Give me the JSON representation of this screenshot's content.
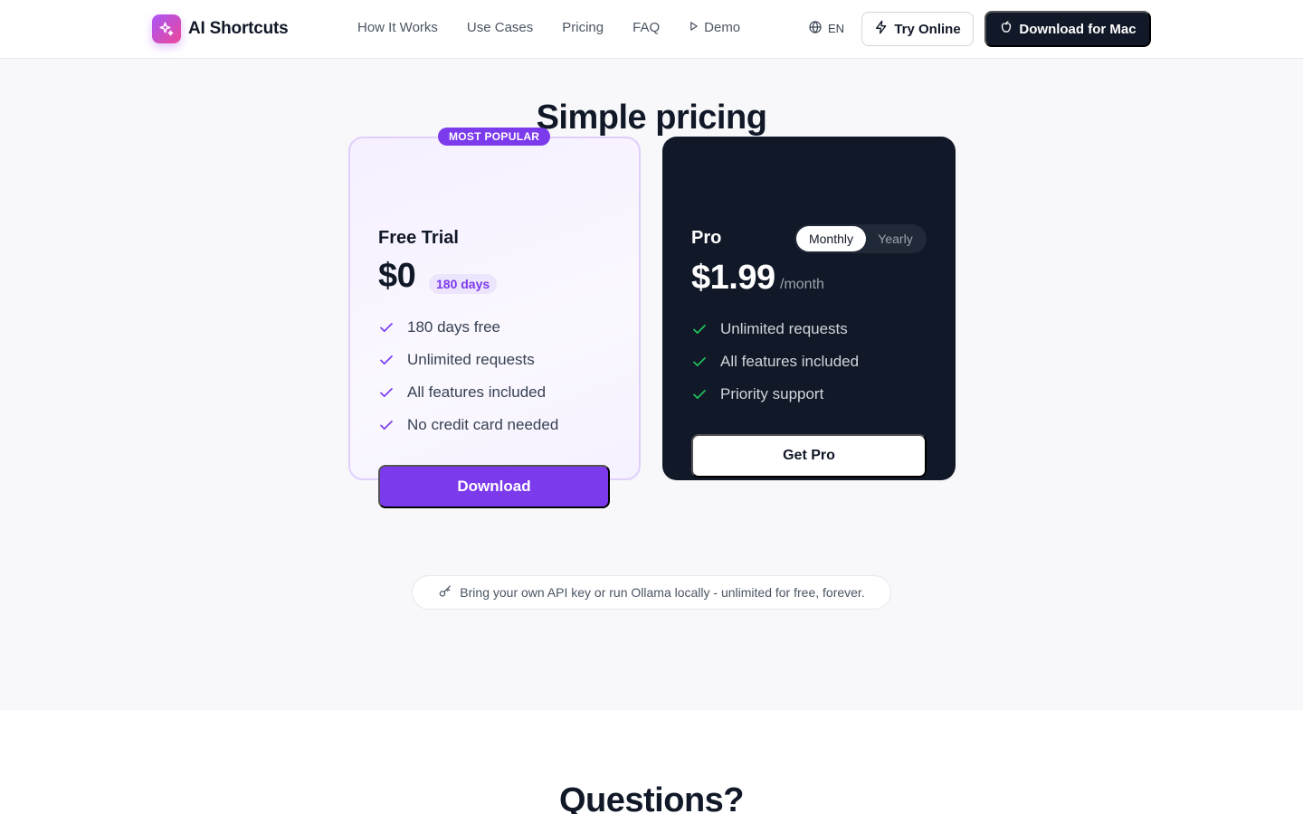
{
  "brand": {
    "name": "AI Shortcuts",
    "logo_icon": "sparkles-icon"
  },
  "nav": {
    "items": [
      {
        "label": "How It Works"
      },
      {
        "label": "Use Cases"
      },
      {
        "label": "Pricing"
      },
      {
        "label": "FAQ"
      },
      {
        "label": "Demo",
        "icon": "play-icon"
      }
    ]
  },
  "header": {
    "language": "EN",
    "try_online": "Try Online",
    "download_mac": "Download for Mac"
  },
  "pricing": {
    "title": "Simple pricing",
    "free": {
      "badge": "MOST POPULAR",
      "name": "Free Trial",
      "price": "$0",
      "duration": "180 days",
      "features": [
        "180 days free",
        "Unlimited requests",
        "All features included",
        "No credit card needed"
      ],
      "cta": "Download"
    },
    "pro": {
      "name": "Pro",
      "billing_options": [
        "Monthly",
        "Yearly"
      ],
      "selected_billing": "Monthly",
      "price": "$1.99",
      "period": "/month",
      "features": [
        "Unlimited requests",
        "All features included",
        "Priority support"
      ],
      "cta": "Get Pro"
    },
    "note": "Bring your own API key or run Ollama locally - unlimited for free, forever."
  },
  "faq": {
    "title": "Questions?"
  },
  "colors": {
    "accent": "#7c3aed",
    "dark": "#111827",
    "check_green": "#22c55e",
    "section_bg": "#f8f8fb"
  }
}
